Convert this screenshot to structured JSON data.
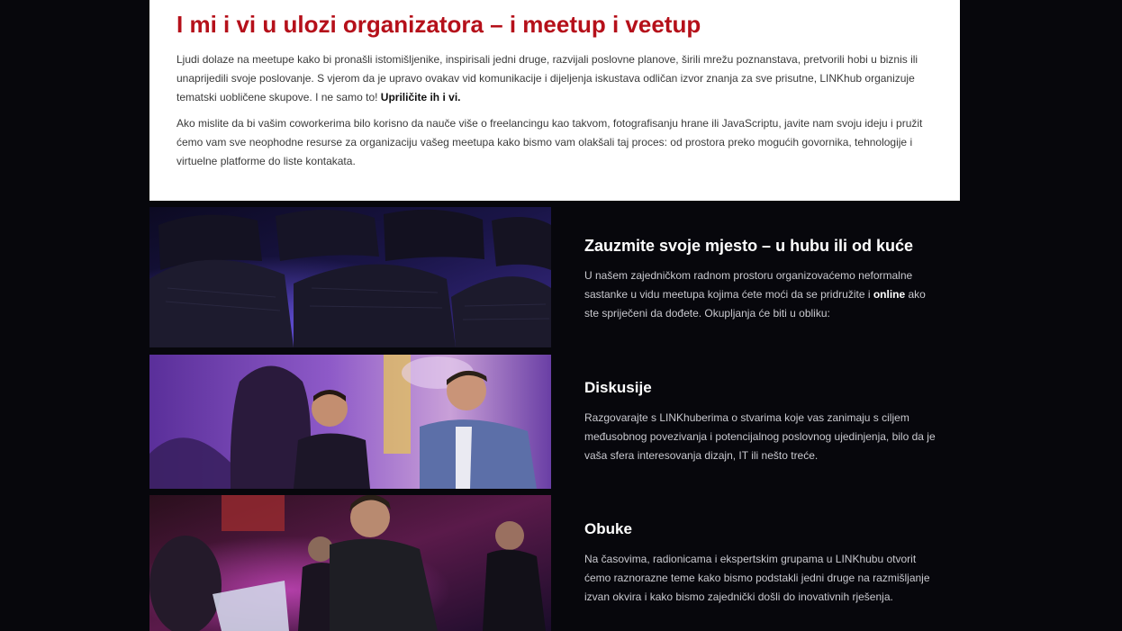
{
  "intro": {
    "title": "I mi i vi u ulozi organizatora – i meetup i veetup",
    "paragraph1": "Ljudi dolaze na meetupe kako bi pronašli istomišljenike, inspirisali jedni druge, razvijali poslovne planove, širili mrežu poznanstava, pretvorili hobi u biznis ili unaprijedili svoje poslovanje. S vjerom da je upravo ovakav vid komunikacije i dijeljenja iskustava odličan izvor znanja za sve prisutne, LINKhub organizuje tematski uobličene skupove. I ne samo to! ",
    "paragraph1_bold": "Upriličite ih i vi.",
    "paragraph2": "Ako mislite da bi vašim coworkerima bilo korisno da nauče više o freelancingu kao takvom, fotografisanju hrane ili JavaScriptu, javite nam svoju ideju i pružit ćemo vam sve neophodne resurse za organizaciju vašeg meetupa kako bismo vam olakšali taj proces: od prostora preko mogućih govornika, tehnologije i virtuelne platforme do liste kontakata."
  },
  "sections": {
    "place": {
      "title": "Zauzmite svoje mjesto – u hubu ili od kuće",
      "text_before": "U našem zajedničkom radnom prostoru organizovaćemo neformalne sastanke u vidu meetupa kojima ćete moći da se pridružite i ",
      "text_bold": "online",
      "text_after": " ako ste spriječeni da dođete. Okupljanja će biti u obliku:"
    },
    "discussions": {
      "title": "Diskusije",
      "text": "Razgovarajte s LINKhuberima o stvarima koje vas zanimaju s ciljem međusobnog povezivanja i potencijalnog poslovnog ujedinjenja, bilo da je vaša sfera interesovanja dizajn, IT ili nešto treće."
    },
    "trainings": {
      "title": "Obuke",
      "text": "Na časovima, radionicama i ekspertskim grupama u LINKhubu otvorit ćemo raznorazne teme kako bismo podstakli jedni druge na razmišljanje izvan okvira i kako bismo zajednički došli do inovativnih rješenja."
    }
  },
  "photos": {
    "photo1": "auditorium-chairs-photo",
    "photo2": "people-talking-photo",
    "photo3": "hackathon-laptop-photo"
  },
  "colors": {
    "background": "#07070c",
    "title_red": "#b5101a",
    "intro_bg": "#ffffff"
  }
}
